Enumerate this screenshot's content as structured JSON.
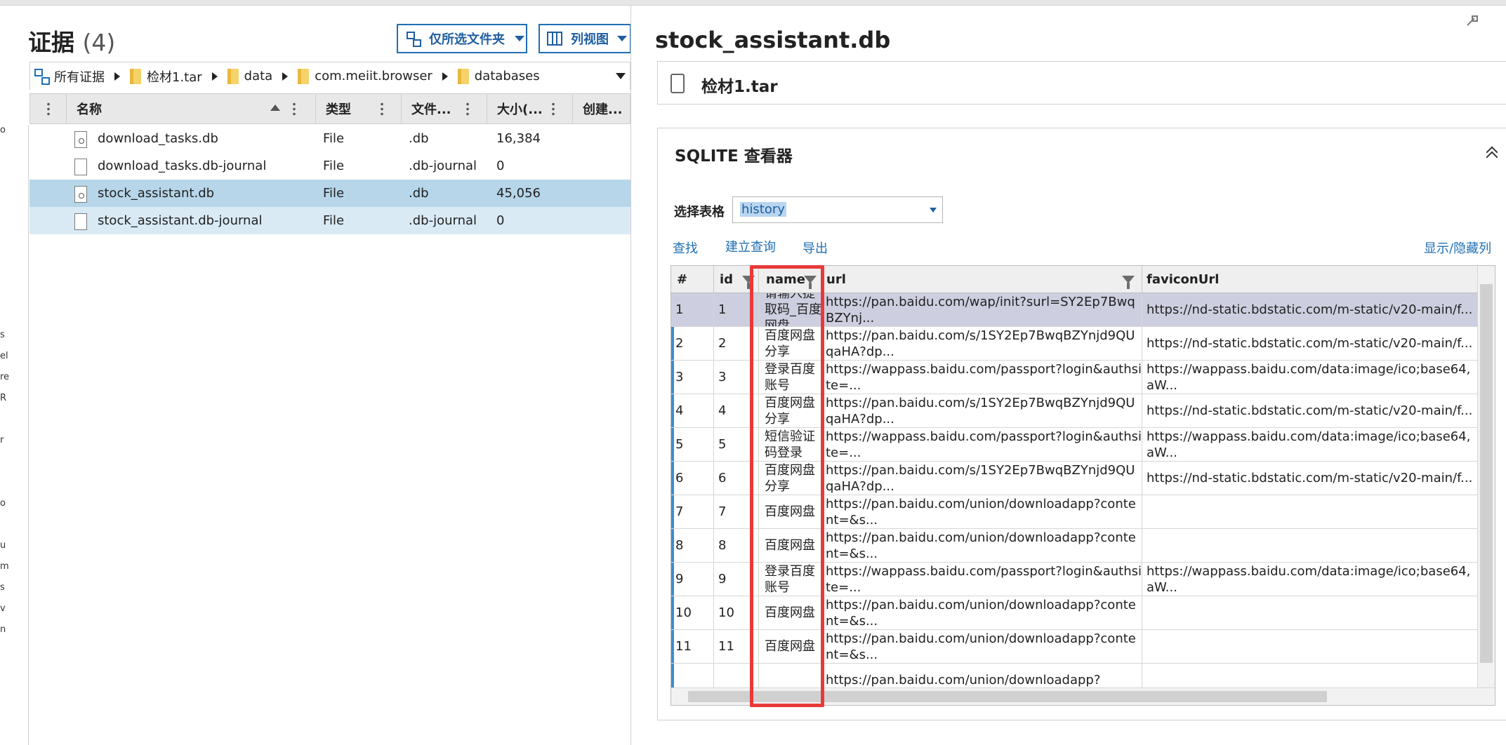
{
  "left_panel": {
    "title": "证据",
    "count": "(4)",
    "folder_button": "仅所选文件夹",
    "view_button": "列视图",
    "breadcrumb": [
      "所有证据",
      "检材1.tar",
      "data",
      "com.meiit.browser",
      "databases"
    ],
    "columns": [
      "名称",
      "类型",
      "文件...",
      "大小(...",
      "创建..."
    ],
    "files": [
      {
        "name": "download_tasks.db",
        "type": "File",
        "ext": ".db",
        "size": "16,384"
      },
      {
        "name": "download_tasks.db-journal",
        "type": "File",
        "ext": ".db-journal",
        "size": "0"
      },
      {
        "name": "stock_assistant.db",
        "type": "File",
        "ext": ".db",
        "size": "45,056"
      },
      {
        "name": "stock_assistant.db-journal",
        "type": "File",
        "ext": ".db-journal",
        "size": "0"
      }
    ],
    "left_edge_fragments": [
      "o",
      "s",
      "el",
      "re",
      "R",
      "r",
      "o",
      "u",
      "m",
      "s",
      "v",
      "n"
    ]
  },
  "right_panel": {
    "title": "stock_assistant.db",
    "source": "检材1.tar",
    "viewer_title": "SQLITE 查看器",
    "select_label": "选择表格",
    "select_value": "history",
    "links": {
      "find": "查找",
      "query": "建立查询",
      "export": "导出",
      "toggle_columns": "显示/隐藏列"
    },
    "grid_columns": [
      "#",
      "id",
      "name",
      "url",
      "faviconUrl"
    ],
    "rows": [
      {
        "n": "1",
        "id": "1",
        "name": "请输入提取码_百度网盘",
        "url": "https://pan.baidu.com/wap/init?surl=SY2Ep7BwqBZYnj...",
        "fav": "https://nd-static.bdstatic.com/m-static/v20-main/f..."
      },
      {
        "n": "2",
        "id": "2",
        "name": "百度网盘分享",
        "url": "https://pan.baidu.com/s/1SY2Ep7BwqBZYnjd9QUqaHA?dp...",
        "fav": "https://nd-static.bdstatic.com/m-static/v20-main/f..."
      },
      {
        "n": "3",
        "id": "3",
        "name": "登录百度账号",
        "url": "https://wappass.baidu.com/passport?login&authsite=...",
        "fav": "https://wappass.baidu.com/data:image/ico;base64,aW..."
      },
      {
        "n": "4",
        "id": "4",
        "name": "百度网盘分享",
        "url": "https://pan.baidu.com/s/1SY2Ep7BwqBZYnjd9QUqaHA?dp...",
        "fav": "https://nd-static.bdstatic.com/m-static/v20-main/f..."
      },
      {
        "n": "5",
        "id": "5",
        "name": "短信验证码登录",
        "url": "https://wappass.baidu.com/passport?login&authsite=...",
        "fav": "https://wappass.baidu.com/data:image/ico;base64,aW..."
      },
      {
        "n": "6",
        "id": "6",
        "name": "百度网盘分享",
        "url": "https://pan.baidu.com/s/1SY2Ep7BwqBZYnjd9QUqaHA?dp...",
        "fav": "https://nd-static.bdstatic.com/m-static/v20-main/f..."
      },
      {
        "n": "7",
        "id": "7",
        "name": "百度网盘",
        "url": "https://pan.baidu.com/union/downloadapp?content=&s...",
        "fav": ""
      },
      {
        "n": "8",
        "id": "8",
        "name": "百度网盘",
        "url": "https://pan.baidu.com/union/downloadapp?content=&s...",
        "fav": ""
      },
      {
        "n": "9",
        "id": "9",
        "name": "登录百度账号",
        "url": "https://wappass.baidu.com/passport?login&authsite=...",
        "fav": "https://wappass.baidu.com/data:image/ico;base64,aW..."
      },
      {
        "n": "10",
        "id": "10",
        "name": "百度网盘",
        "url": "https://pan.baidu.com/union/downloadapp?content=&s...",
        "fav": ""
      },
      {
        "n": "11",
        "id": "11",
        "name": "百度网盘",
        "url": "https://pan.baidu.com/union/downloadapp?content=&s...",
        "fav": ""
      },
      {
        "n": "",
        "id": "",
        "name": "",
        "url": "https://pan.baidu.com/union/downloadapp?",
        "fav": ""
      }
    ]
  }
}
